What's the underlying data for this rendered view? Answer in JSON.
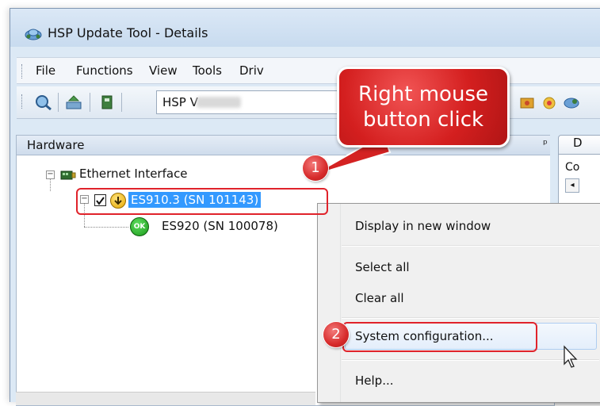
{
  "window": {
    "title": "HSP Update Tool - Details"
  },
  "menubar": {
    "items": [
      "File",
      "Functions",
      "View",
      "Tools",
      "Driv"
    ]
  },
  "toolbar": {
    "version_label": "HSP V"
  },
  "hardware_panel": {
    "title": "Hardware",
    "pin_glyph": "⬣"
  },
  "right_panel": {
    "tab_label": "D",
    "content_label": "Co"
  },
  "tree": {
    "root": {
      "label": "Ethernet Interface",
      "expander": "−"
    },
    "child1": {
      "label": "ES910.3  (SN 101143)",
      "expander": "−",
      "checked": true
    },
    "child2": {
      "label": "ES920  (SN 100078)",
      "status_icon_text": "OK"
    }
  },
  "annotations": {
    "callout_text": "Right mouse button click",
    "callout_line1": "Right mouse",
    "callout_line2": "button click",
    "badge1": "1",
    "badge2": "2",
    "accent_color": "#d72b2b"
  },
  "context_menu": {
    "items": [
      {
        "label": "Display in new window"
      },
      {
        "label": "Select all"
      },
      {
        "label": "Clear all"
      },
      {
        "label": "System configuration..."
      },
      {
        "label": "Help..."
      }
    ],
    "highlighted": "System configuration..."
  }
}
